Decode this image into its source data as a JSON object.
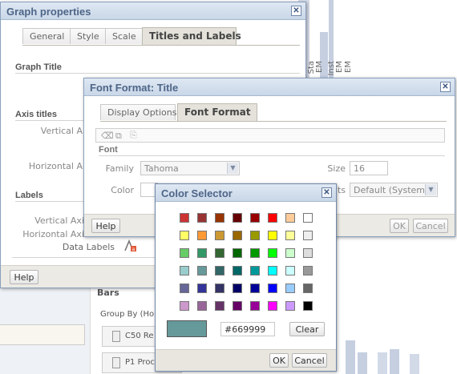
{
  "graph_properties": {
    "title": "Graph properties",
    "tabs": [
      "General",
      "Style",
      "Scale",
      "Titles and Labels"
    ],
    "active_tab": "Titles and Labels",
    "sections": {
      "graph_title": "Graph Title",
      "axis_titles": "Axis titles",
      "labels": "Labels"
    },
    "axis_rows": [
      "Vertical A",
      "Horizontal A"
    ],
    "label_rows": [
      "Vertical Axi",
      "Horizontal Axi",
      "Data Labels"
    ],
    "help_label": "Help"
  },
  "font_format": {
    "title": "Font Format: Title",
    "tabs": [
      "Display Options",
      "Font Format"
    ],
    "active_tab": "Font Format",
    "font_section": "Font",
    "family_label": "Family",
    "family_value": "Tahoma",
    "size_label": "Size",
    "size_value": "16",
    "color_label": "Color",
    "effects_label_partial": "ts",
    "effects_value": "Default (System)",
    "help_label": "Help",
    "ok_label": "OK",
    "cancel_label": "Cancel"
  },
  "color_selector": {
    "title": "Color Selector",
    "hex_value": "#669999",
    "preview_color": "#669999",
    "clear_label": "Clear",
    "ok_label": "OK",
    "cancel_label": "Cancel",
    "palette": [
      [
        "#CC3333",
        "#993333",
        "#993300",
        "#660000",
        "#990000",
        "#FF0000",
        "#FFCC99",
        "#FFFFFF"
      ],
      [
        "#FFFF66",
        "#FF9933",
        "#CC9933",
        "#996600",
        "#999900",
        "#FFFF00",
        "#FFFF99",
        "#EEEEEE"
      ],
      [
        "#66CC66",
        "#339966",
        "#336633",
        "#006600",
        "#009900",
        "#00FF00",
        "#CCFFCC",
        "#DDDDDD"
      ],
      [
        "#99CCCC",
        "#669999",
        "#336666",
        "#006666",
        "#009999",
        "#00FFFF",
        "#CCFFFF",
        "#999999"
      ],
      [
        "#666699",
        "#333399",
        "#333366",
        "#000066",
        "#000099",
        "#0000FF",
        "#99CCFF",
        "#666666"
      ],
      [
        "#CC99CC",
        "#996699",
        "#663366",
        "#660066",
        "#990099",
        "#FF00FF",
        "#CC99FF",
        "#000000"
      ]
    ]
  },
  "background": {
    "bars_label": "Bars",
    "group_by_label": "Group By (Hor",
    "item1": "C50  Re",
    "item2": "P1  Proc",
    "chart_labels": [
      "EM",
      "Sta",
      "EM",
      "Inst",
      "EM"
    ]
  }
}
